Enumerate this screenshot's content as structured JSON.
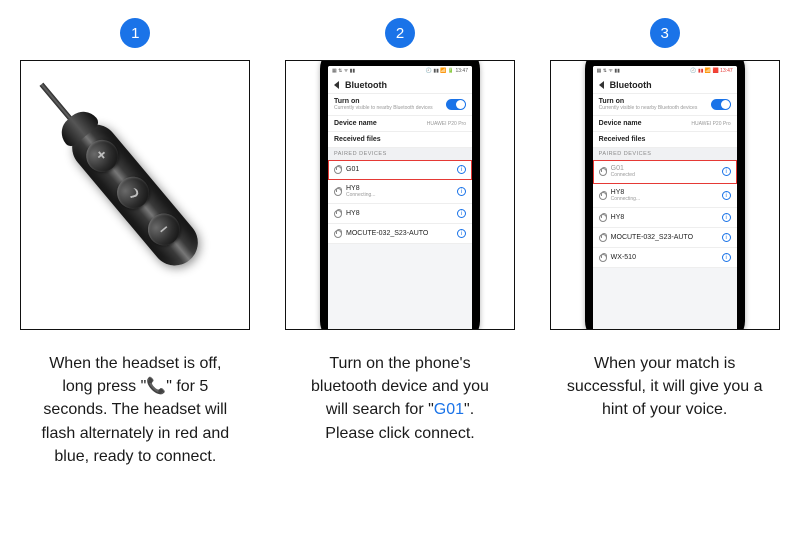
{
  "steps": [
    {
      "num": "1",
      "caption_pre": "When the headset is off, long press \"",
      "caption_icon": "phone-call-icon",
      "caption_post": "\" for 5 seconds. The headset will flash alternately in red and blue, ready to connect."
    },
    {
      "num": "2",
      "caption_pre": "Turn on the phone's bluetooth device and you will search for \"",
      "caption_hl": "G01",
      "caption_post": "\". Please click connect."
    },
    {
      "num": "3",
      "caption": "When your match is successful, it will give you a hint of your voice."
    }
  ],
  "remote_buttons": [
    "+",
    "call",
    "–"
  ],
  "phone": {
    "status_left": "▦ ⇅ ᯤ ▮▮",
    "status_right_ok": "🕘 ▮▮ 📶 🔋 13:47",
    "status_right_low": "🕘 ▮▮ 📶 🟥 13:47",
    "title": "Bluetooth",
    "turn_on": {
      "label": "Turn on",
      "sub": "Currently visible to nearby Bluetooth devices"
    },
    "device_name": {
      "label": "Device name",
      "value": "HUAWEI P20 Pro"
    },
    "received": "Received files",
    "paired_hdr": "PAIRED DEVICES",
    "devs_search": [
      {
        "name": "G01",
        "status": "",
        "boxed": true
      },
      {
        "name": "HY8",
        "status": "Connecting..."
      },
      {
        "name": "HY8",
        "status": ""
      },
      {
        "name": "MOCUTE-032_S23-AUTO",
        "status": ""
      }
    ],
    "devs_connected": [
      {
        "name": "G01",
        "status": "Connected",
        "boxed": true,
        "connected": true
      },
      {
        "name": "HY8",
        "status": "Connecting..."
      },
      {
        "name": "HY8",
        "status": ""
      },
      {
        "name": "MOCUTE-032_S23-AUTO",
        "status": ""
      },
      {
        "name": "WX-510",
        "status": ""
      }
    ]
  }
}
